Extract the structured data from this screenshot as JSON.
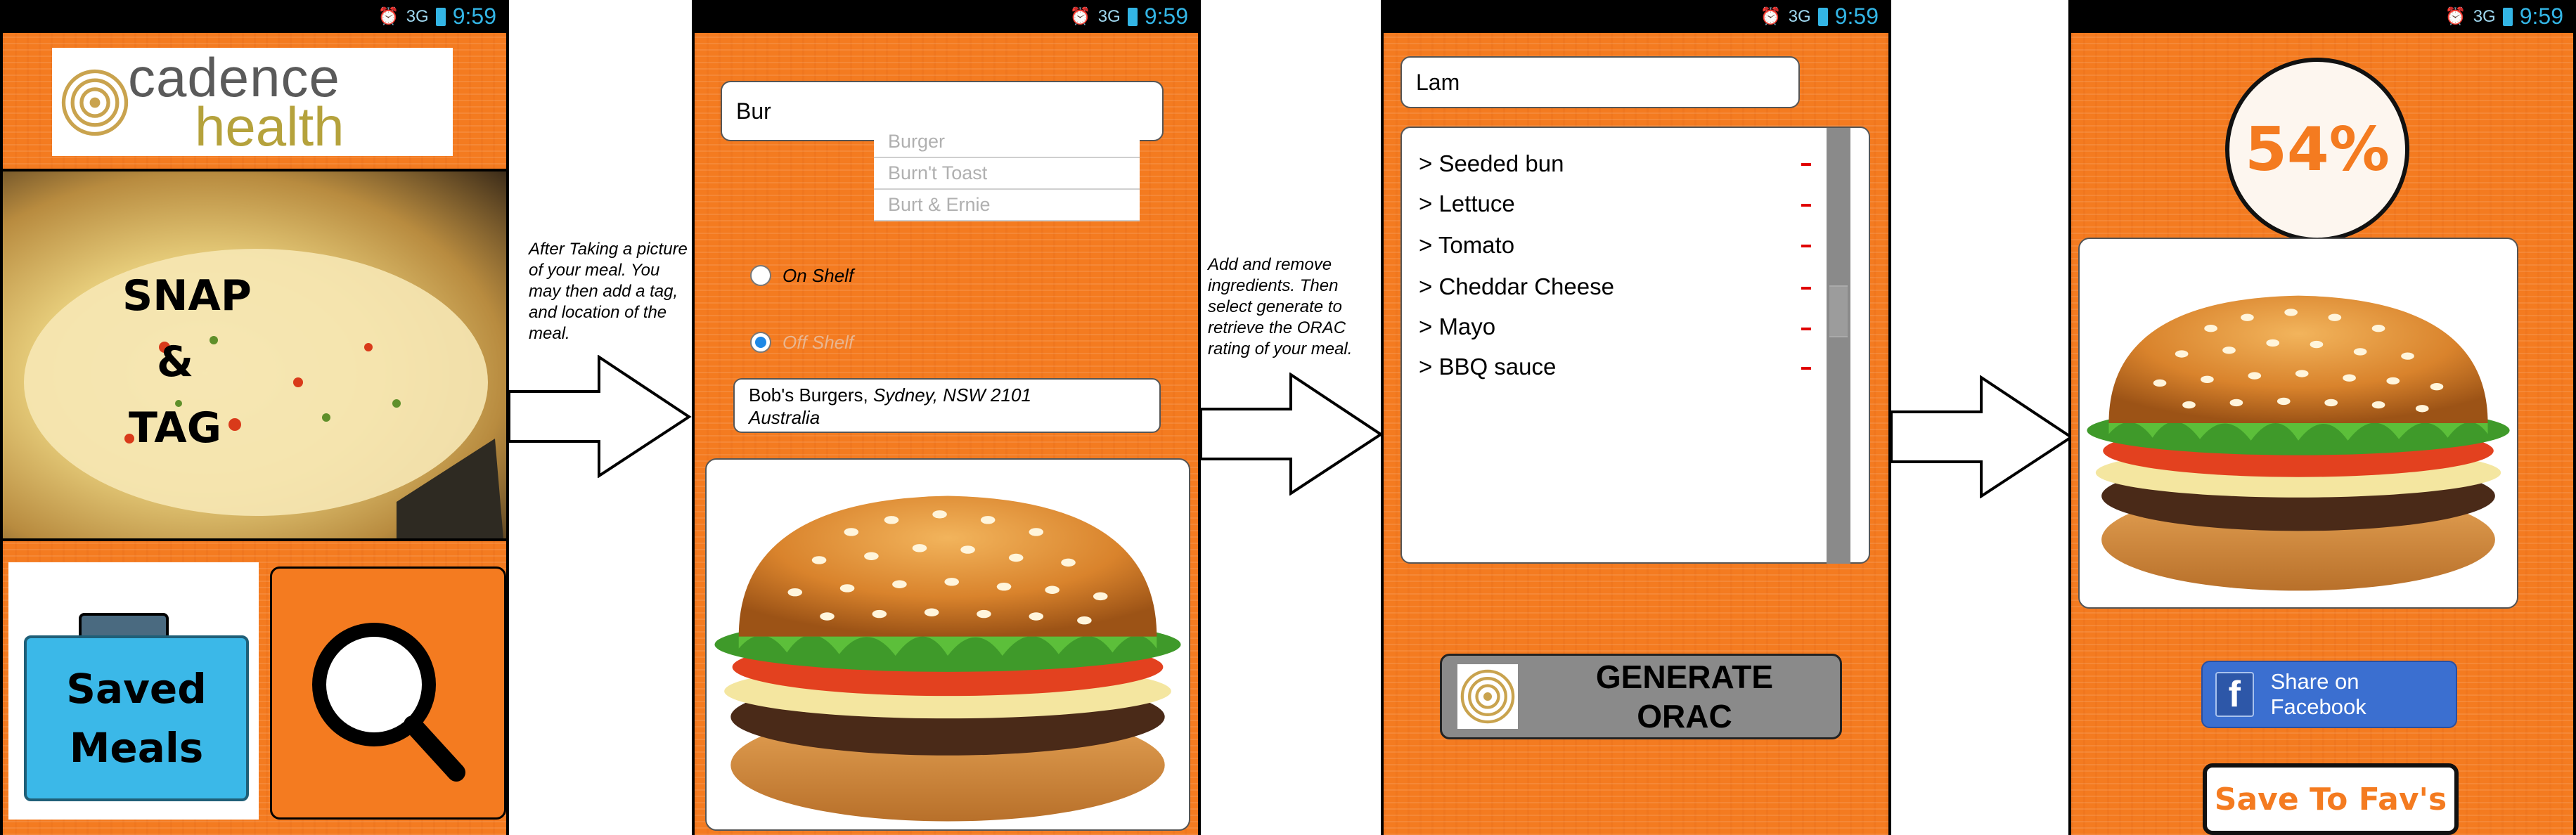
{
  "status_bar": {
    "network": "3G",
    "time": "9:59"
  },
  "screen1": {
    "logo_line1": "cadence",
    "logo_line2": "health",
    "hero_lines": [
      "SNAP",
      "&",
      "TAG"
    ],
    "saved_meals_lines": [
      "Saved",
      "Meals"
    ]
  },
  "caption1": "After Taking a picture of your meal. You may then add a tag, and location of the meal.",
  "screen2": {
    "search_value": "Bur",
    "suggestions": [
      "Burger",
      "Burn't Toast",
      "Burt & Ernie"
    ],
    "radio_on_shelf": "On Shelf",
    "radio_off_shelf": "Off Shelf",
    "radio_selected": "Off Shelf",
    "location_name": "Bob's Burgers, ",
    "location_city": "Sydney, NSW 2101",
    "location_country": "Australia"
  },
  "caption2": "Add and remove ingredients. Then select generate to retrieve the ORAC rating of your meal.",
  "screen3": {
    "search_value": "Lam",
    "ingredients": [
      "> Seeded bun",
      "> Lettuce",
      "> Tomato",
      "> Cheddar Cheese",
      "> Mayo",
      "> BBQ sauce"
    ],
    "remove_symbol": "-",
    "generate_lines": [
      "GENERATE",
      "ORAC"
    ]
  },
  "screen4": {
    "score": "54%",
    "facebook_icon_letter": "f",
    "facebook_label": "Share on Facebook",
    "save_label": "Save To Fav's"
  },
  "colors": {
    "orange": "#f47b20",
    "status_time": "#33b5e5",
    "facebook_blue": "#3b6fd0",
    "remove_red": "#e00000"
  }
}
